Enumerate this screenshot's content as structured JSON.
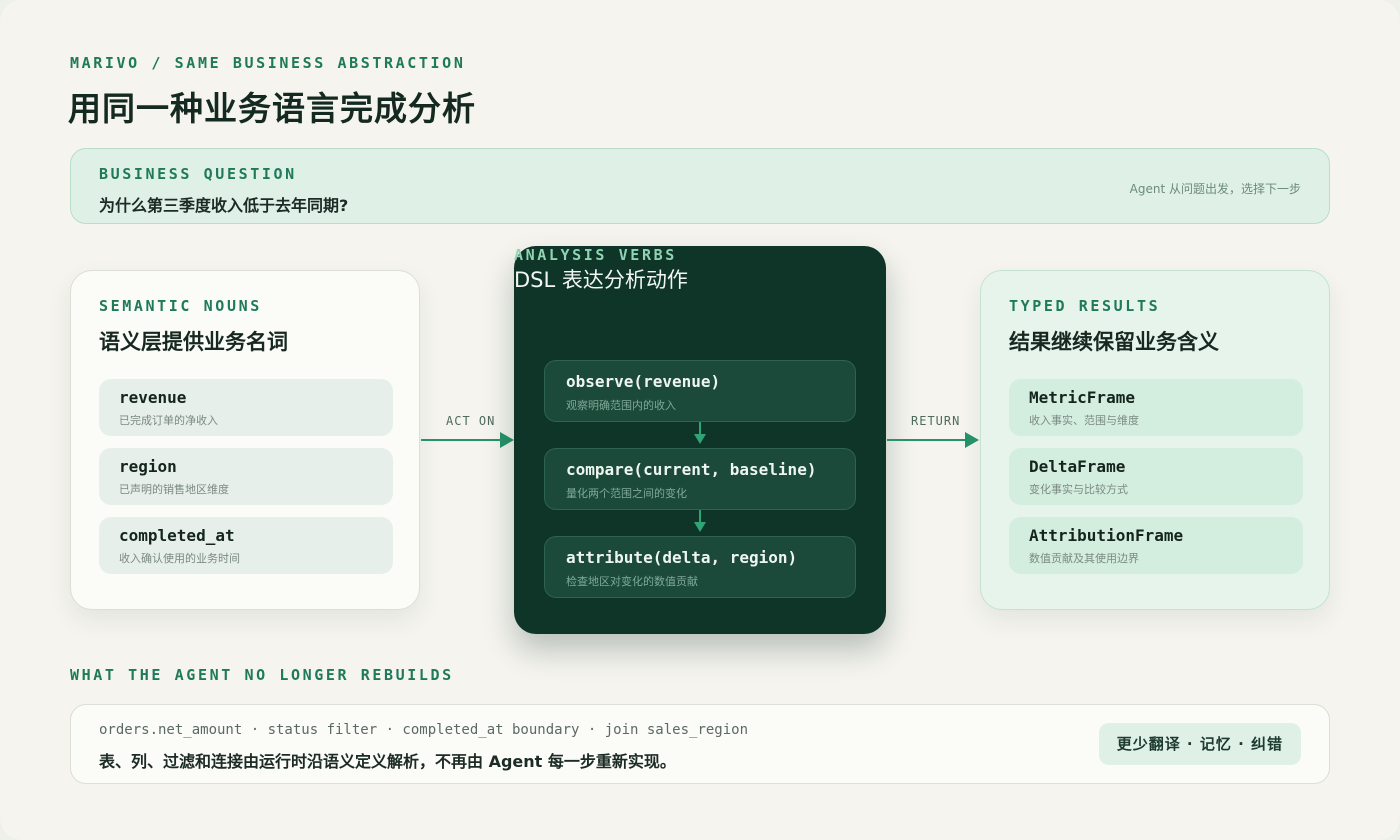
{
  "header": {
    "kicker": "MARIVO / SAME BUSINESS ABSTRACTION",
    "title": "用同一种业务语言完成分析"
  },
  "question": {
    "eyebrow": "BUSINESS QUESTION",
    "text": "为什么第三季度收入低于去年同期?",
    "hint": "Agent 从问题出发，选择下一步"
  },
  "nouns": {
    "eyebrow": "SEMANTIC NOUNS",
    "title": "语义层提供业务名词",
    "items": [
      {
        "code": "revenue",
        "desc": "已完成订单的净收入"
      },
      {
        "code": "region",
        "desc": "已声明的销售地区维度"
      },
      {
        "code": "completed_at",
        "desc": "收入确认使用的业务时间"
      }
    ]
  },
  "verbs": {
    "eyebrow": "ANALYSIS VERBS",
    "title": "DSL 表达分析动作",
    "items": [
      {
        "code": "observe(revenue)",
        "desc": "观察明确范围内的收入"
      },
      {
        "code": "compare(current, baseline)",
        "desc": "量化两个范围之间的变化"
      },
      {
        "code": "attribute(delta, region)",
        "desc": "检查地区对变化的数值贡献"
      }
    ]
  },
  "results": {
    "eyebrow": "TYPED RESULTS",
    "title": "结果继续保留业务含义",
    "items": [
      {
        "code": "MetricFrame",
        "desc": "收入事实、范围与维度"
      },
      {
        "code": "DeltaFrame",
        "desc": "变化事实与比较方式"
      },
      {
        "code": "AttributionFrame",
        "desc": "数值贡献及其使用边界"
      }
    ]
  },
  "arrows": {
    "act_on": "ACT ON",
    "return": "RETURN"
  },
  "bottom": {
    "eyebrow": "WHAT THE AGENT NO LONGER REBUILDS",
    "code": "orders.net_amount · status filter · completed_at boundary · join sales_region",
    "text": "表、列、过滤和连接由运行时沿语义定义解析，不再由 Agent 每一步重新实现。",
    "badge": "更少翻译 · 记忆 · 纠错"
  },
  "colors": {
    "accent": "#1e7a58",
    "dark_panel": "#0f3428",
    "light_green": "#dff1e7"
  }
}
